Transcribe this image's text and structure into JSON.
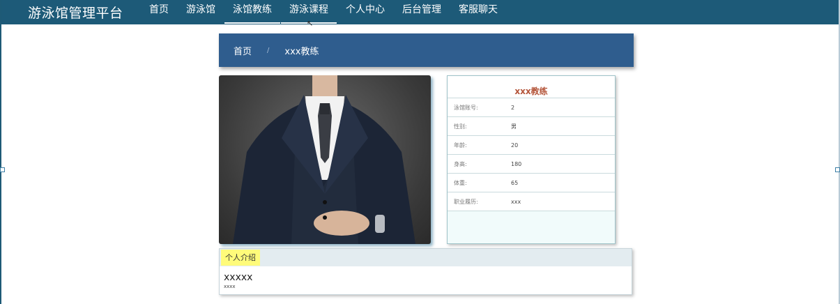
{
  "brand": "游泳馆管理平台",
  "nav": [
    {
      "label": "首页"
    },
    {
      "label": "游泳馆"
    },
    {
      "label": "泳馆教练"
    },
    {
      "label": "游泳课程"
    },
    {
      "label": "个人中心"
    },
    {
      "label": "后台管理"
    },
    {
      "label": "客服聊天"
    }
  ],
  "breadcrumb": {
    "home": "首页",
    "sep": "/",
    "current": "xxx教练"
  },
  "coach": {
    "title": "xxx教练",
    "rows": [
      {
        "label": "泳馆账号:",
        "value": "2"
      },
      {
        "label": "性别:",
        "value": "男"
      },
      {
        "label": "年龄:",
        "value": "20"
      },
      {
        "label": "身高:",
        "value": "180"
      },
      {
        "label": "体重:",
        "value": "65"
      },
      {
        "label": "职业履历:",
        "value": "xxx"
      }
    ]
  },
  "intro": {
    "tag": "个人介绍",
    "heading": "xxxxx",
    "text": "xxxx"
  },
  "colors": {
    "topbar": "#1d5a78",
    "banner": "#2f5d8e",
    "title_accent": "#b4553a",
    "tag": "#fffb7a"
  }
}
